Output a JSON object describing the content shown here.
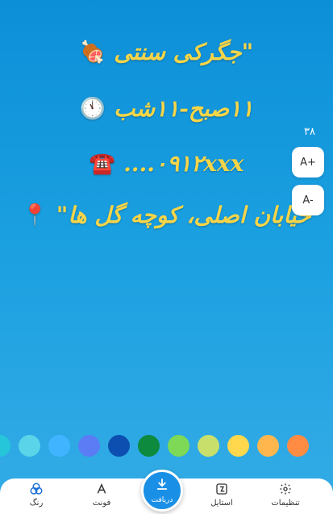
{
  "poster": {
    "lines": [
      {
        "text": "\"جگرکی سنتی",
        "emoji": "🍖",
        "emoji_name": "meat-on-bone-icon"
      },
      {
        "text": "۱۱صبح-۱۱شب",
        "emoji": "🕚",
        "emoji_name": "clock-icon"
      },
      {
        "text": "۰۹۱۲xxx....",
        "emoji": "☎️",
        "emoji_name": "telephone-icon"
      },
      {
        "text": "خیابان اصلی، کوچه گل ها\"",
        "emoji": "📍",
        "emoji_name": "pushpin-icon"
      }
    ],
    "text_color": "#f7d548"
  },
  "font_size": {
    "value": "۳۸",
    "increase_label": "A+",
    "decrease_label": "A-"
  },
  "palette": {
    "colors": [
      "#26c6da",
      "#5ad4e8",
      "#40b4ff",
      "#5b7cf5",
      "#0d4fb0",
      "#0d8a3e",
      "#7ed957",
      "#c8e06b",
      "#ffd84d",
      "#ffb74d",
      "#ff8c42"
    ]
  },
  "nav": {
    "settings": "تنظیمات",
    "style": "استایل",
    "download": "دریافت",
    "font": "فونت",
    "color": "رنگ"
  },
  "theme": {
    "background_top": "#0d8fd8",
    "background_bottom": "#34ace6",
    "fab_color": "#1a8fe6"
  }
}
